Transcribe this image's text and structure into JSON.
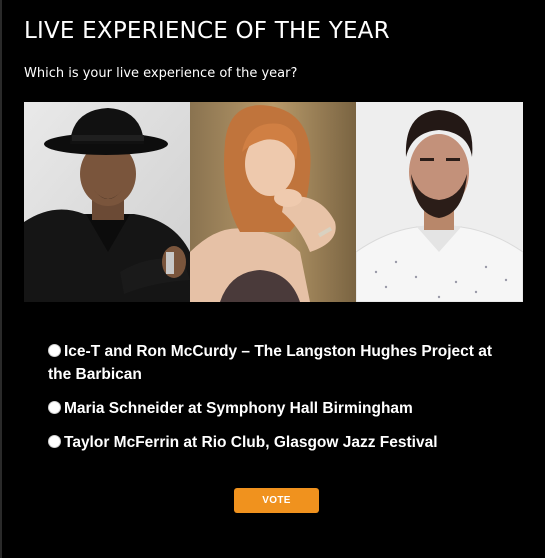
{
  "poll": {
    "title": "LIVE EXPERIENCE OF THE YEAR",
    "question": "Which is your live experience of the year?",
    "options": [
      {
        "label": "Ice-T and Ron McCurdy – The Langston Hughes Project at the Barbican"
      },
      {
        "label": "Maria Schneider at Symphony Hall Birmingham"
      },
      {
        "label": "Taylor McFerrin at Rio Club, Glasgow Jazz Festival"
      }
    ],
    "vote_label": "VOTE"
  },
  "colors": {
    "background": "#000000",
    "accent": "#f0921e",
    "text": "#ffffff"
  }
}
